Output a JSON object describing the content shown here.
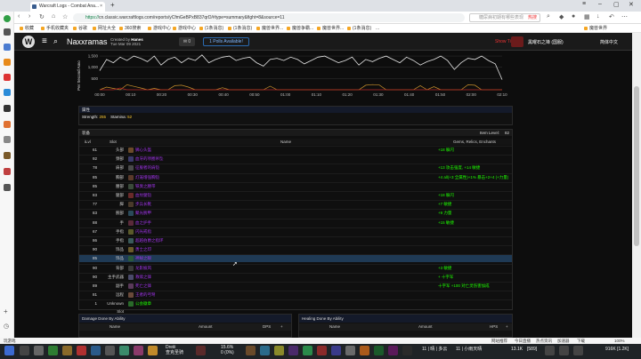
{
  "browser": {
    "tab_title": "Warcraft Logs - Combat Ana...",
    "tab_close": "×",
    "new_tab": "+",
    "url_secure": "https://",
    "url_rest": "cn.classic.warcraftlogs.com/reports/yCfmGeBPxB837qrD/#type=summary&fight=8&source=11",
    "search_placeholder": "糖尿病初期有哪些表现",
    "search_hot": "热搜",
    "bookmarks": [
      "收藏",
      "手机收藏夹",
      "谷歌",
      "网址大全",
      "360搜索",
      "游戏中心",
      "游戏中心",
      "(1条消息)",
      "(1条消息)",
      "魔兽世界...",
      "魔兽争霸...",
      "魔兽世界...",
      "(1条消息)",
      "...",
      "魔兽世界"
    ]
  },
  "site": {
    "logo": "W",
    "zone_title": "Naxxramas",
    "created_by_label": "Created by",
    "creator": "Hanes",
    "date": "Tue Mar 09 2021",
    "chat_count": "0",
    "polls_label": "1 Polls Available!",
    "show_time": "Show Time",
    "guild": "黑曜石之锋 (国服)",
    "language": "简体中文"
  },
  "chart_data": {
    "type": "line",
    "ylabel": "Per Second Amo",
    "yticks": [
      "1,500",
      "1,000",
      "500"
    ],
    "xticks": [
      "00:00",
      "00:10",
      "00:20",
      "00:30",
      "00:40",
      "00:50",
      "01:00",
      "01:10",
      "01:20",
      "01:30",
      "01:40",
      "01:50",
      "02:00",
      "02:10"
    ],
    "series": [
      {
        "color": "#e6e6e6",
        "values": [
          850,
          1350,
          1200,
          1450,
          1300,
          1500,
          1400,
          1250,
          1500,
          1100,
          1350,
          1450,
          1200,
          1400,
          1300,
          1550,
          1200,
          1350,
          1450,
          1500,
          1300,
          1400,
          1450,
          1200,
          1050,
          1350,
          1400,
          1300,
          1450,
          1350,
          1150,
          1300,
          1450,
          1500,
          1350,
          1200,
          1300,
          1450,
          1100,
          1350,
          1250,
          1400,
          1500,
          1350,
          1200,
          1450,
          1300,
          1100,
          1250,
          1350,
          1500,
          1300,
          900,
          1200,
          1400,
          1350,
          1500,
          1300,
          1150,
          450
        ]
      },
      {
        "color": "#c8902c",
        "values": [
          0,
          120,
          60,
          0,
          220,
          150,
          80,
          0,
          60,
          0,
          0,
          180,
          200,
          120,
          0,
          0,
          0,
          0,
          90,
          0,
          0,
          0,
          0,
          0,
          0,
          160,
          0,
          0,
          0,
          0,
          0,
          0,
          0,
          0,
          0,
          0,
          0,
          0,
          0,
          200,
          230,
          210,
          0,
          0,
          0,
          0,
          0,
          180,
          0,
          140,
          0,
          0,
          0,
          0,
          220,
          200,
          0,
          0,
          0,
          0
        ]
      },
      {
        "color": "#b02020",
        "values": [
          0,
          0,
          0,
          80,
          0,
          0,
          0,
          0,
          0,
          0,
          0,
          0,
          0,
          0,
          0,
          0,
          0,
          0,
          0,
          0,
          0,
          0,
          0,
          0,
          0,
          0,
          0,
          0,
          0,
          0,
          0,
          0,
          0,
          0,
          0,
          0,
          0,
          0,
          0,
          0,
          0,
          0,
          0,
          0,
          0,
          0,
          0,
          0,
          0,
          0,
          0,
          0,
          0,
          0,
          0,
          0,
          0,
          0,
          0,
          0
        ]
      }
    ],
    "ylim": [
      0,
      1700
    ]
  },
  "stats": {
    "header": "属性",
    "strength_label": "Strength:",
    "strength": "255",
    "stamina_label": "Stamina:",
    "stamina": "52"
  },
  "gear": {
    "header": "装备",
    "item_level_label": "Item Level:",
    "item_level": "82",
    "col_ilvl": "iLvl",
    "col_slot": "Slot",
    "col_name": "Name",
    "col_gems": "Gems, Relics, Enchants",
    "rows": [
      {
        "ilvl": "61",
        "slot": "头部",
        "name": "狮心头盔",
        "extra": "+18 躲闪",
        "color": "#a335ee",
        "icon": "#6a4a2a"
      },
      {
        "ilvl": "92",
        "slot": "颈部",
        "name": "血牙的项圈吊坠",
        "extra": "",
        "color": "#a335ee",
        "icon": "#3a3a6a"
      },
      {
        "ilvl": "78",
        "slot": "肩部",
        "name": "征服者的肩铠",
        "extra": "+13 攻击强度, +14 敏捷",
        "color": "#a335ee",
        "icon": "#4a4a4a"
      },
      {
        "ilvl": "85",
        "slot": "胸部",
        "name": "灯笼增强胸铠",
        "extra": "+4 all(+3 全属性)+1% 暴击+2+4 (+力量)",
        "color": "#a335ee",
        "icon": "#5a3a2a"
      },
      {
        "ilvl": "85",
        "slot": "腰部",
        "name": "铁臭之腰带",
        "extra": "",
        "color": "#a335ee",
        "icon": "#3a4a3a"
      },
      {
        "ilvl": "83",
        "slot": "腿部",
        "name": "血纹腿铠",
        "extra": "+18 躲闪",
        "color": "#a335ee",
        "icon": "#6a2a2a"
      },
      {
        "ilvl": "77",
        "slot": "脚",
        "name": "步兵长靴",
        "extra": "+7 敏捷",
        "color": "#a335ee",
        "icon": "#4a3a2a"
      },
      {
        "ilvl": "83",
        "slot": "腕部",
        "name": "聚光腕甲",
        "extra": "+9 力量",
        "color": "#a335ee",
        "icon": "#2a4a5a"
      },
      {
        "ilvl": "88",
        "slot": "手",
        "name": "血之护手",
        "extra": "+15 敏捷",
        "color": "#a335ee",
        "icon": "#5a2a3a"
      },
      {
        "ilvl": "67",
        "slot": "手指",
        "name": "闪光戒指",
        "extra": "",
        "color": "#a335ee",
        "icon": "#5a5a2a"
      },
      {
        "ilvl": "86",
        "slot": "手指",
        "name": "超越伯爵之指环",
        "extra": "",
        "color": "#a335ee",
        "icon": "#3a5a5a"
      },
      {
        "ilvl": "90",
        "slot": "饰品",
        "name": "勇士之印",
        "extra": "",
        "color": "#a335ee",
        "icon": "#6a5a2a"
      },
      {
        "ilvl": "85",
        "slot": "饰品",
        "name": "神秘之眼",
        "extra": "",
        "color": "#a335ee",
        "icon": "#2a5a3a",
        "highlight": true
      },
      {
        "ilvl": "90",
        "slot": "背部",
        "name": "龙影披风",
        "extra": "+3 敏捷",
        "color": "#a335ee",
        "icon": "#3a3a3a"
      },
      {
        "ilvl": "90",
        "slot": "主手武器",
        "name": "救赎之锋",
        "extra": "+ 十字军",
        "color": "#a335ee",
        "icon": "#4a4a6a"
      },
      {
        "ilvl": "89",
        "slot": "副手",
        "name": "死亡之锋",
        "extra": "十字军 +100 对亡灵伤害加成",
        "color": "#a335ee",
        "icon": "#5a3a5a"
      },
      {
        "ilvl": "81",
        "slot": "远程",
        "name": "王者的弓弩",
        "extra": "",
        "color": "#a335ee",
        "icon": "#6a4a3a"
      },
      {
        "ilvl": "1",
        "slot": "Unknown Slot",
        "name": "公会徽章",
        "extra": "",
        "color": "#1eff00",
        "icon": "#2a6a2a"
      }
    ]
  },
  "damage_table": {
    "header": "Damage Done By Ability",
    "col_name": "Name",
    "col_amount": "Amount",
    "col_dps": "DPS"
  },
  "healing_table": {
    "header": "Healing Done By Ability",
    "col_name": "Name",
    "col_amount": "Amount",
    "col_hps": "HPS"
  },
  "statusbar": {
    "left": "玩游戏",
    "right_items": [
      "网站推荐",
      "今日直播",
      "热点资讯",
      "加速器",
      "下载",
      "100%"
    ]
  },
  "taskbar": {
    "app1_line1": "Dreiii",
    "app1_line2": "查克圣骑",
    "stats_line1": "15.6%",
    "stats_line2": "0 (0%)",
    "weather": "11 | 晴 | 多云",
    "weather2": "11 | 小雨天晴",
    "net1": "13.1K",
    "net2": "[589]",
    "speed": "916K [1.2K]"
  }
}
